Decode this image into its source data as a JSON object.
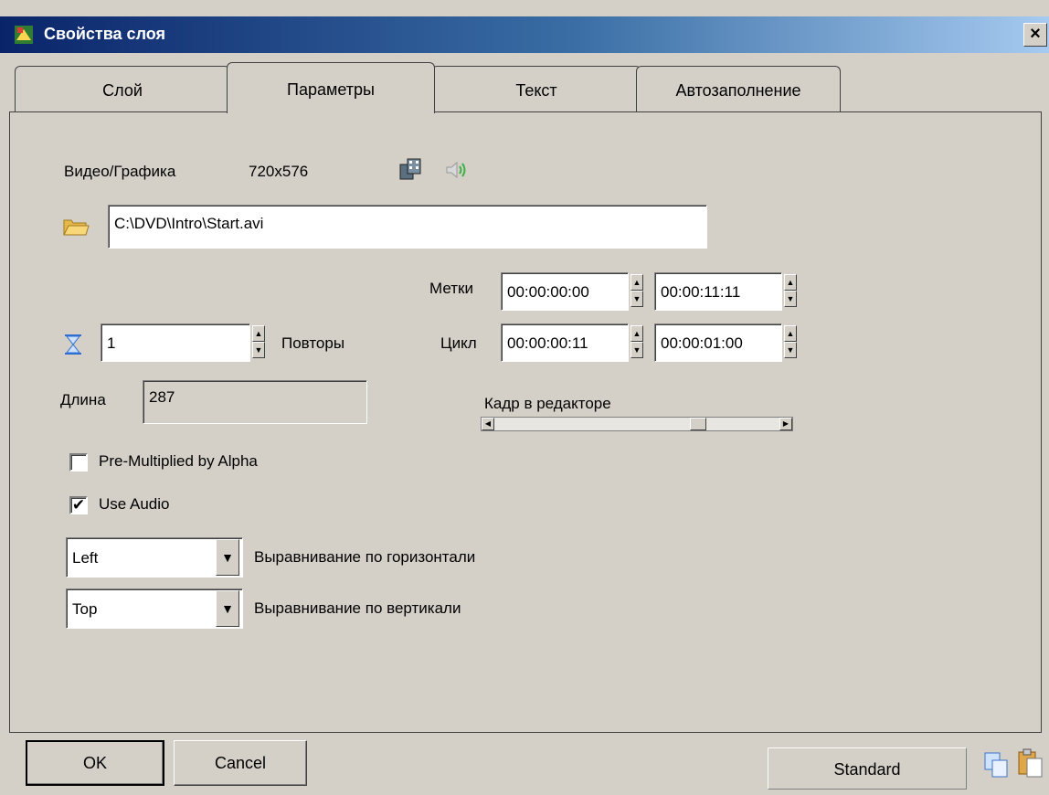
{
  "window": {
    "title": "Свойства слоя",
    "close_glyph": "×",
    "icon": "app-layer-icon",
    "titlebar_colors": [
      "#0a246a",
      "#a6caf0"
    ]
  },
  "tabs": [
    {
      "label": "Слой",
      "active": false
    },
    {
      "label": "Параметры",
      "active": true
    },
    {
      "label": "Текст",
      "active": false
    },
    {
      "label": "Автозаполнение",
      "active": false
    }
  ],
  "media": {
    "label": "Видео/Графика",
    "resolution": "720x576",
    "file_path": "C:\\DVD\\Intro\\Start.avi",
    "icons": [
      "film-strip-icon",
      "speaker-icon",
      "folder-open-icon"
    ]
  },
  "marks": {
    "label": "Метки",
    "start": "00:00:00:00",
    "end": "00:00:11:11"
  },
  "loop": {
    "label": "Цикл",
    "start": "00:00:00:11",
    "end": "00:00:01:00"
  },
  "repeats": {
    "label": "Повторы",
    "value": "1",
    "icon": "hourglass-icon"
  },
  "length": {
    "label": "Длина",
    "value": "287"
  },
  "editor_frame": {
    "label": "Кадр в редакторе",
    "position": 0.73
  },
  "options": {
    "premultiplied": {
      "label": "Pre-Multiplied by Alpha",
      "checked": false
    },
    "use_audio": {
      "label": "Use Audio",
      "checked": true,
      "check_glyph": "✔"
    }
  },
  "align_h": {
    "value": "Left",
    "label": "Выравнивание по горизонтали"
  },
  "align_v": {
    "value": "Top",
    "label": "Выравнивание по вертикали"
  },
  "buttons": {
    "ok": "OK",
    "cancel": "Cancel",
    "standard": "Standard"
  },
  "glyphs": {
    "spin_up": "▲",
    "spin_down": "▼",
    "combo_arrow": "▼",
    "scroll_left": "◀",
    "scroll_right": "▶"
  },
  "footer_icons": [
    "copy-icon",
    "paste-icon"
  ]
}
